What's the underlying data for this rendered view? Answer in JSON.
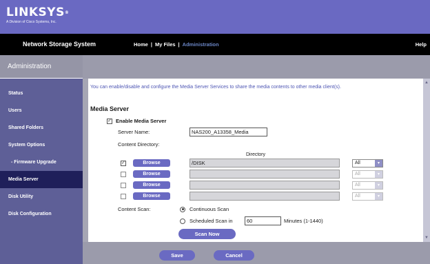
{
  "brand": {
    "name": "LINKSYS",
    "tagline": "A Division of Cisco Systems, Inc."
  },
  "app_title": "Network Storage System",
  "nav": {
    "home": "Home",
    "my_files": "My Files",
    "administration": "Administration",
    "separator": "|",
    "help": "Help",
    "active": "administration"
  },
  "sidebar": {
    "title": "Administration",
    "items": [
      {
        "label": "Status"
      },
      {
        "label": "Users"
      },
      {
        "label": "Shared Folders"
      },
      {
        "label": "System Options"
      },
      {
        "label": "- Firmware Upgrade"
      },
      {
        "label": "Media Server",
        "active": true
      },
      {
        "label": "Disk Utility"
      },
      {
        "label": "Disk Configuration"
      }
    ]
  },
  "main": {
    "intro": "You can enable/disable and configure the Media Server Services to share the media contents to other media client(s).",
    "section_title": "Media Server",
    "enable": {
      "label": "Enable Media Server",
      "checked": true
    },
    "server_name": {
      "label": "Server Name:",
      "value": "NAS200_A13358_Media"
    },
    "content_directory": {
      "label": "Content Directory:",
      "column_header": "Directory",
      "browse_label": "Browse",
      "rows": [
        {
          "checked": true,
          "path": "/DISK",
          "option": "All",
          "enabled": true
        },
        {
          "checked": false,
          "path": "",
          "option": "All",
          "enabled": false
        },
        {
          "checked": false,
          "path": "",
          "option": "All",
          "enabled": false
        },
        {
          "checked": false,
          "path": "",
          "option": "All",
          "enabled": false
        }
      ]
    },
    "content_scan": {
      "label": "Content Scan:",
      "continuous": "Continuous Scan",
      "scheduled_prefix": "Scheduled Scan in",
      "scheduled_value": "60",
      "scheduled_suffix": "Minutes (1-1440)",
      "selected": "continuous",
      "scan_now": "Scan Now"
    }
  },
  "footer": {
    "save": "Save",
    "cancel": "Cancel"
  },
  "colors": {
    "brand_purple": "#6a69c2",
    "sidebar_bg": "#5e5f97",
    "sidebar_active": "#1f1f5a",
    "intro_text": "#4d55b3",
    "button": "#6a6ac2"
  },
  "icons": {
    "checkbox_check": "✓",
    "select_caret": "▾",
    "scroll_up": "▲",
    "scroll_down": "▼"
  }
}
